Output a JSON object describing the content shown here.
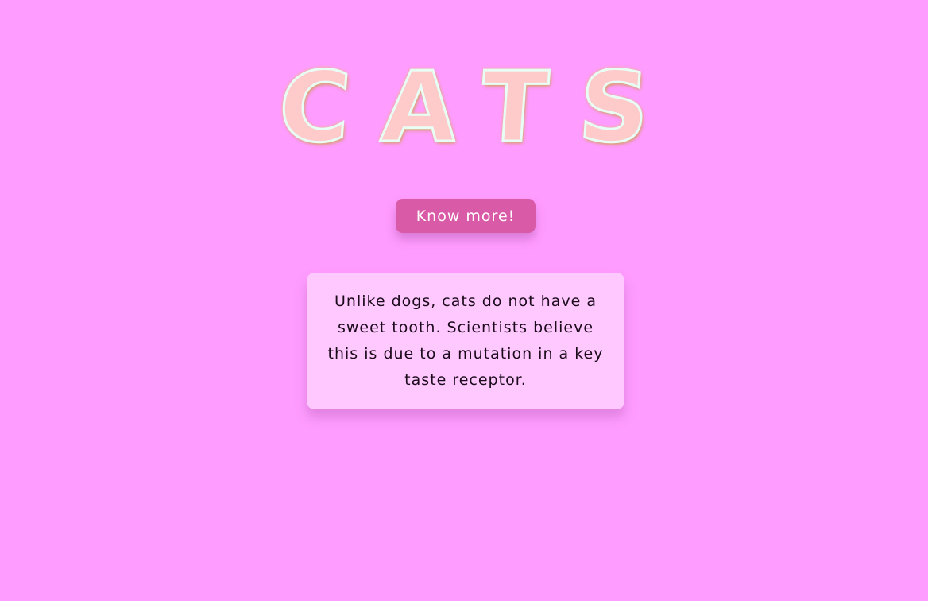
{
  "header": {
    "title": "CATS"
  },
  "actions": {
    "know_more_label": "Know more!"
  },
  "fact": {
    "text": "Unlike dogs, cats do not have a sweet tooth. Scientists believe this is due to a mutation in a key taste receptor."
  },
  "colors": {
    "background": "#ff9cff",
    "title_fill": "#ffcaca",
    "button": "#d95aa7",
    "card": "#ffc8ff"
  }
}
